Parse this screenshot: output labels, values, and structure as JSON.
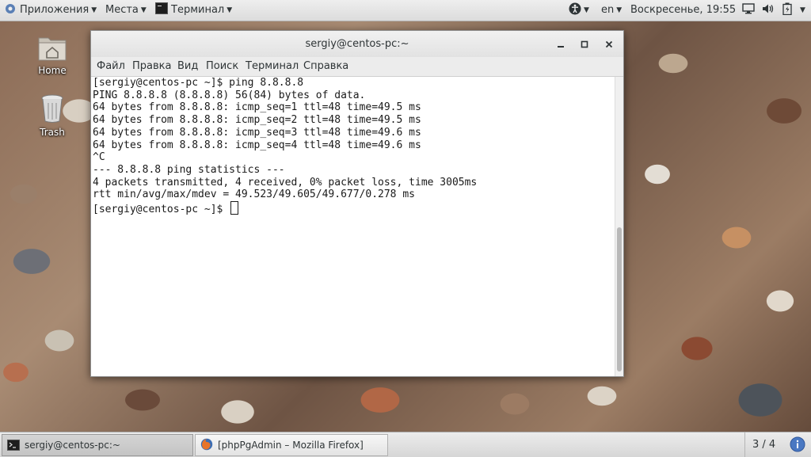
{
  "top_panel": {
    "applications": "Приложения",
    "places": "Места",
    "active_app": "Терминал",
    "language": "en",
    "clock": "Воскресенье, 19:55"
  },
  "desktop": {
    "icons": [
      {
        "label": "Home",
        "icon": "home-folder-icon"
      },
      {
        "label": "Trash",
        "icon": "trash-icon"
      }
    ]
  },
  "window": {
    "title": "sergiy@centos-pc:~",
    "menu": [
      "Файл",
      "Правка",
      "Вид",
      "Поиск",
      "Терминал",
      "Справка"
    ],
    "terminal_lines": [
      "[sergiy@centos-pc ~]$ ping 8.8.8.8",
      "PING 8.8.8.8 (8.8.8.8) 56(84) bytes of data.",
      "64 bytes from 8.8.8.8: icmp_seq=1 ttl=48 time=49.5 ms",
      "64 bytes from 8.8.8.8: icmp_seq=2 ttl=48 time=49.5 ms",
      "64 bytes from 8.8.8.8: icmp_seq=3 ttl=48 time=49.6 ms",
      "64 bytes from 8.8.8.8: icmp_seq=4 ttl=48 time=49.6 ms",
      "^C",
      "--- 8.8.8.8 ping statistics ---",
      "4 packets transmitted, 4 received, 0% packet loss, time 3005ms",
      "rtt min/avg/max/mdev = 49.523/49.605/49.677/0.278 ms",
      "[sergiy@centos-pc ~]$ "
    ]
  },
  "taskbar": {
    "tasks": [
      {
        "label": "sergiy@centos-pc:~",
        "icon": "terminal-icon",
        "active": true
      },
      {
        "label": "[phpPgAdmin – Mozilla Firefox]",
        "icon": "firefox-icon",
        "active": false
      }
    ],
    "workspace": "3 / 4",
    "notification_icon": "info-icon"
  }
}
